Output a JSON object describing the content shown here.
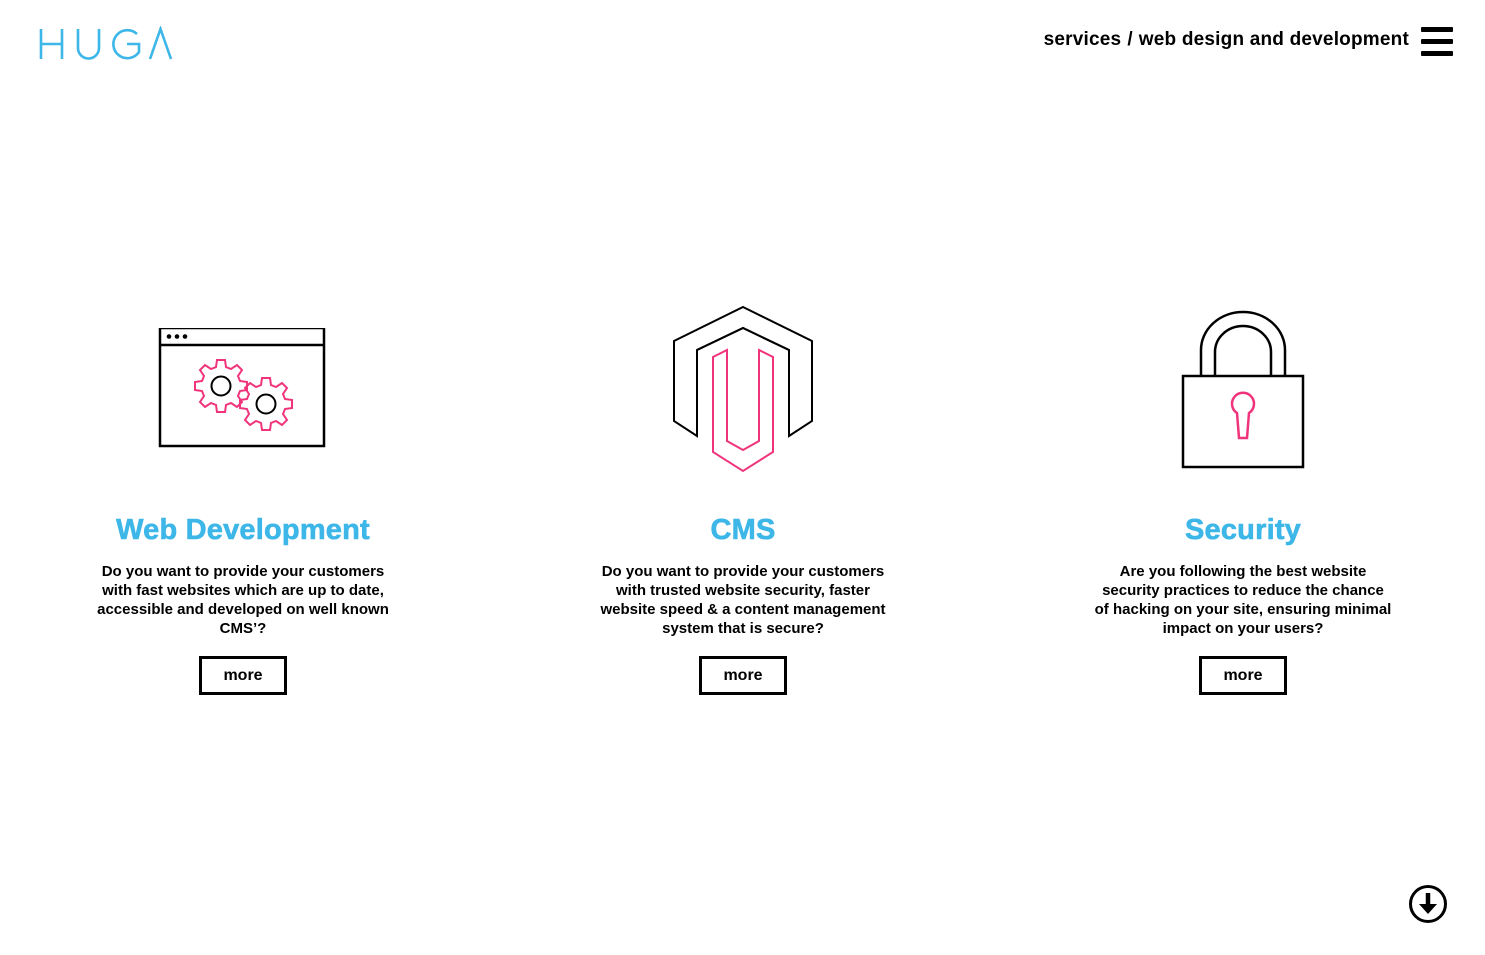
{
  "brand": {
    "logo_text": "HUGA",
    "accent_color": "#3db6e8",
    "highlight_color": "#f0347c"
  },
  "header": {
    "breadcrumb": {
      "parent": "services",
      "separator": "/",
      "current": "web design and development"
    },
    "menu_icon": "hamburger-icon"
  },
  "services": [
    {
      "icon": "browser-gears-icon",
      "title": "Web Development",
      "description": "Do you want to provide your customers with fast websites which are up to date, accessible and developed on well known CMS’?",
      "button_label": "more"
    },
    {
      "icon": "magento-logo-icon",
      "title": "CMS",
      "description": "Do you want to provide your customers with trusted website security, faster website speed & a content management system that is secure?",
      "button_label": "more"
    },
    {
      "icon": "padlock-icon",
      "title": "Security",
      "description": "Are you following the best website security practices to reduce the chance of hacking on your site, ensuring minimal impact on your users?",
      "button_label": "more"
    }
  ],
  "scroll_button": {
    "icon": "arrow-down-circle-icon"
  }
}
